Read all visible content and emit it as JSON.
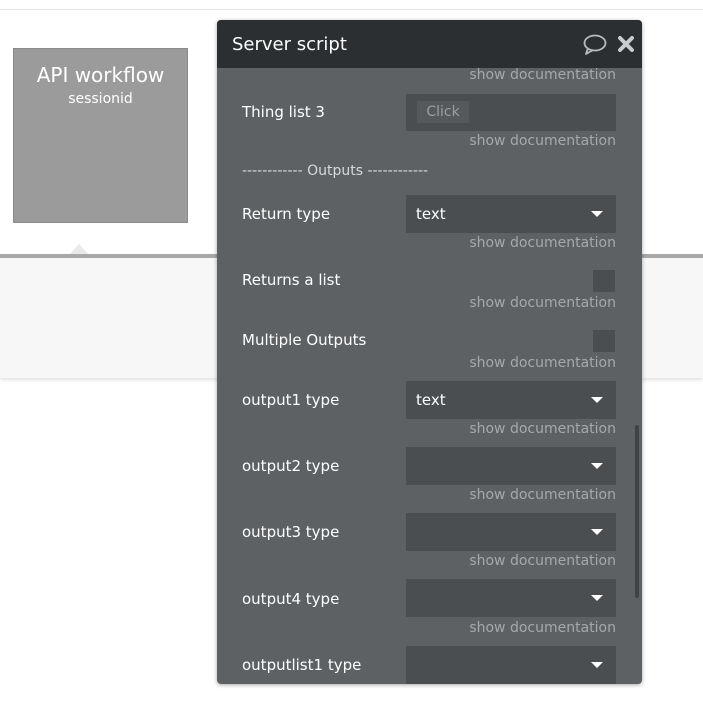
{
  "workflow": {
    "title": "API workflow",
    "subtitle": "sessionid"
  },
  "panel": {
    "title": "Server script",
    "show_doc": "show documentation",
    "thing_list_3": {
      "label": "Thing list 3",
      "button": "Click"
    },
    "outputs_divider": "------------ Outputs ------------",
    "return_type": {
      "label": "Return type",
      "value": "text"
    },
    "returns_list": {
      "label": "Returns a list"
    },
    "multiple_outputs": {
      "label": "Multiple Outputs"
    },
    "output1": {
      "label": "output1 type",
      "value": "text"
    },
    "output2": {
      "label": "output2 type",
      "value": ""
    },
    "output3": {
      "label": "output3 type",
      "value": ""
    },
    "output4": {
      "label": "output4 type",
      "value": ""
    },
    "outputlist1": {
      "label": "outputlist1 type",
      "value": ""
    }
  },
  "icons": {
    "comment": "comment-icon",
    "close": "close-icon"
  },
  "colors": {
    "panel": "#5d6164",
    "header": "#2b2f32",
    "field": "#4b4e51",
    "doc_text": "#a5a9ac"
  }
}
